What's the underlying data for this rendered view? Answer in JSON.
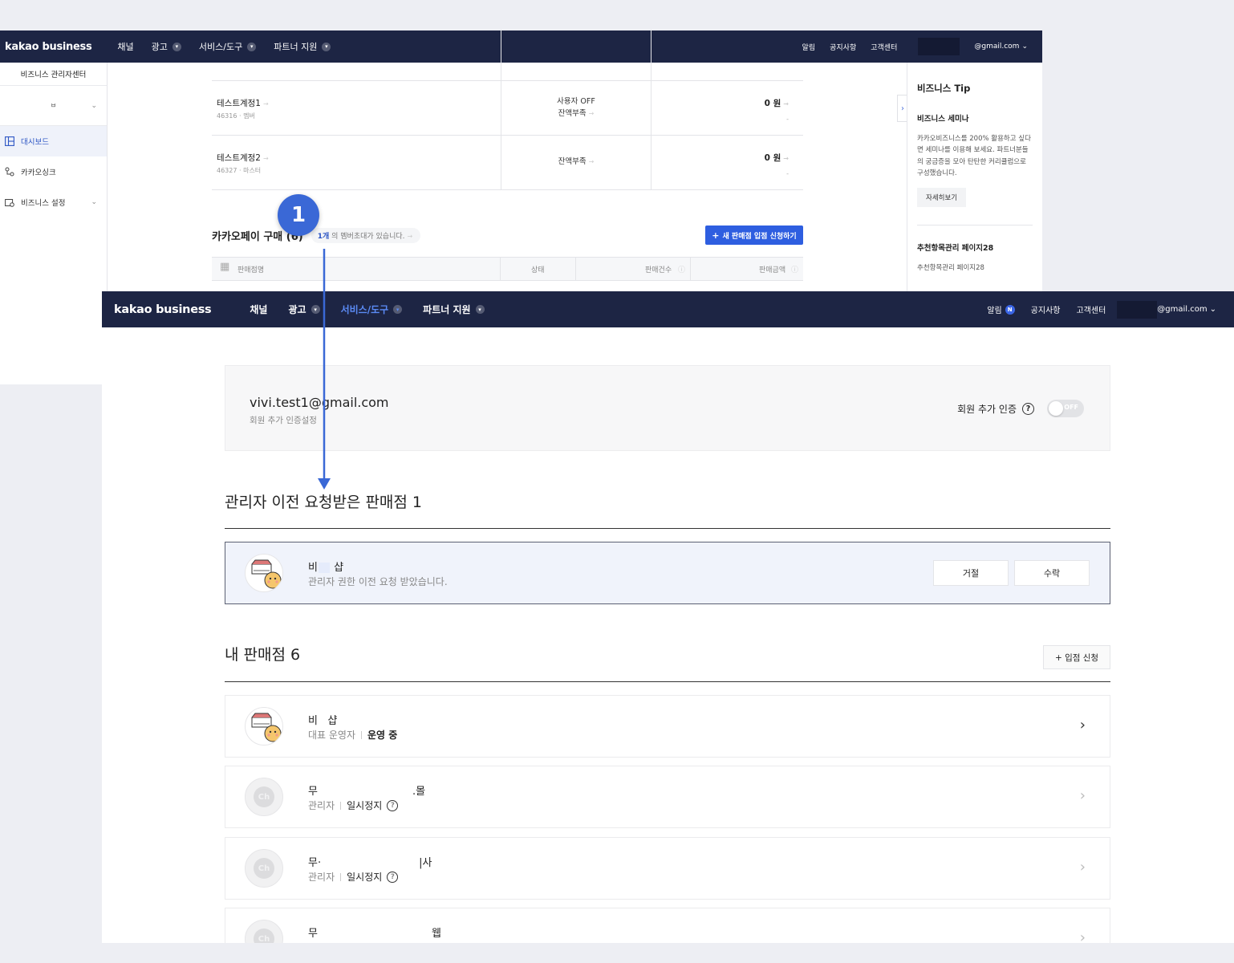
{
  "back_window": {
    "nav": {
      "logo": "kakao business",
      "items": [
        {
          "label": "채널",
          "has_dropdown": false
        },
        {
          "label": "광고",
          "has_dropdown": true
        },
        {
          "label": "서비스/도구",
          "has_dropdown": true
        },
        {
          "label": "파트너 지원",
          "has_dropdown": true
        }
      ],
      "right": {
        "notice": "알림",
        "announcements": "공지사항",
        "support": "고객센터",
        "email_suffix": "@gmail.com"
      }
    },
    "sidebar": {
      "title": "비즈니스 관리자센터",
      "selector_value": "ㅂ",
      "items": [
        {
          "label": "대시보드",
          "icon": "dashboard-icon",
          "active": true
        },
        {
          "label": "카카오싱크",
          "icon": "sync-icon",
          "active": false
        },
        {
          "label": "비즈니스 설정",
          "icon": "settings-icon",
          "active": false
        }
      ]
    },
    "account_rows": [
      {
        "name": "테스트계정1",
        "id_role": "46316 · 멤버",
        "status_line1": "사용자 OFF",
        "status_line2": "잔액부족",
        "amount": "0 원",
        "sub": "-"
      },
      {
        "name": "테스트계정2",
        "id_role": "46327 · 마스터",
        "status_line1": "",
        "status_line2": "잔액부족",
        "amount": "0 원",
        "sub": "-"
      }
    ],
    "kakaopay": {
      "title": "카카오페이 구매 (6)",
      "invite_count": "1개",
      "invite_text": "의 멤버초대가 있습니다.",
      "new_store_button": "새 판매점 입점 신청하기",
      "columns": [
        "판매점명",
        "상태",
        "판매건수",
        "판매금액"
      ]
    },
    "tip_panel": {
      "title": "비즈니스 Tip",
      "seminar_title": "비즈니스 세미나",
      "seminar_text": "카카오비즈니스를 200% 활용하고 싶다면 세미나를 이용해 보세요. 파트너분들의 궁금증을 모아 탄탄한 커리큘럼으로 구성했습니다.",
      "more_button": "자세히보기",
      "recommend_title": "추천항목관리 페이지28",
      "recommend_text": "추천항목관리 페이지28"
    }
  },
  "front_window": {
    "nav": {
      "logo": "kakao business",
      "items": [
        {
          "label": "채널",
          "has_dropdown": false,
          "active": false
        },
        {
          "label": "광고",
          "has_dropdown": true,
          "active": false
        },
        {
          "label": "서비스/도구",
          "has_dropdown": true,
          "active": true
        },
        {
          "label": "파트너 지원",
          "has_dropdown": true,
          "active": false
        }
      ],
      "right": {
        "notice": "알림",
        "notice_badge": "N",
        "announcements": "공지사항",
        "support": "고객센터",
        "email_suffix": "@gmail.com"
      }
    },
    "account": {
      "email": "vivi.test1@gmail.com",
      "subtitle": "회원 추가 인증설정",
      "auth_label": "회원 추가 인증",
      "toggle_label": "OFF"
    },
    "transfer_section": {
      "title": "관리자 이전 요청받은 판매점 1",
      "request": {
        "name_prefix": "비",
        "name_suffix": "샵",
        "message": "관리자 권한 이전 요청 받았습니다.",
        "reject_button": "거절",
        "accept_button": "수락"
      }
    },
    "my_stores": {
      "title": "내 판매점 6",
      "join_button": "+ 입점 신청",
      "stores": [
        {
          "name_prefix": "비",
          "name_suffix": "샵",
          "role": "대표 운영자",
          "status": "운영 중",
          "has_help": false
        },
        {
          "name_prefix": "무",
          "name_suffix": ".몰",
          "role": "관리자",
          "status": "일시정지",
          "has_help": true
        },
        {
          "name_prefix": "무·",
          "name_suffix": "|사",
          "role": "관리자",
          "status": "일시정지",
          "has_help": true
        },
        {
          "name_prefix": "무",
          "name_suffix": "웹",
          "role": "",
          "status": "",
          "has_help": false
        }
      ]
    }
  },
  "annotation": {
    "marker": "1"
  },
  "colors": {
    "nav_bg": "#1d2544",
    "accent": "#2e5ee0",
    "marker": "#3a68d6"
  }
}
